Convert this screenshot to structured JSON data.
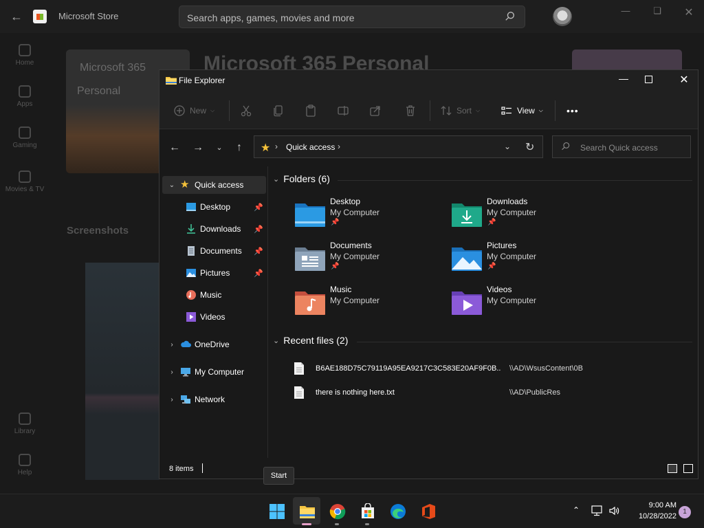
{
  "store": {
    "title": "Microsoft Store",
    "search_placeholder": "Search apps, games, movies and more",
    "nav": [
      "Home",
      "Apps",
      "Gaming",
      "Movies & TV",
      "Library",
      "Help"
    ],
    "hero_card_line1": "Microsoft 365",
    "hero_card_line2": "Personal",
    "heading": "Microsoft 365 Personal",
    "screenshots_label": "Screenshots"
  },
  "explorer": {
    "title": "File Explorer",
    "ribbon": {
      "new_label": "New",
      "sort_label": "Sort",
      "view_label": "View",
      "more_label": "•••"
    },
    "address": {
      "location": "Quick access"
    },
    "search_placeholder": "Search Quick access",
    "sidebar": {
      "items": [
        {
          "label": "Quick access",
          "icon": "star-icon",
          "pinned": false
        },
        {
          "label": "Desktop",
          "icon": "desktop-icon",
          "pinned": true
        },
        {
          "label": "Downloads",
          "icon": "download-icon",
          "pinned": true
        },
        {
          "label": "Documents",
          "icon": "document-icon",
          "pinned": true
        },
        {
          "label": "Pictures",
          "icon": "pictures-icon",
          "pinned": true
        },
        {
          "label": "Music",
          "icon": "music-icon",
          "pinned": false
        },
        {
          "label": "Videos",
          "icon": "video-icon",
          "pinned": false
        },
        {
          "label": "OneDrive",
          "icon": "cloud-icon",
          "pinned": false
        },
        {
          "label": "My Computer",
          "icon": "computer-icon",
          "pinned": false
        },
        {
          "label": "Network",
          "icon": "network-icon",
          "pinned": false
        }
      ]
    },
    "folders_header": "Folders (6)",
    "folders": [
      {
        "name": "Desktop",
        "location": "My Computer",
        "pinned": true,
        "icon": "desktop-folder-icon",
        "color": "#2b9ae3"
      },
      {
        "name": "Downloads",
        "location": "My Computer",
        "pinned": true,
        "icon": "downloads-folder-icon",
        "color": "#1fa98a"
      },
      {
        "name": "Documents",
        "location": "My Computer",
        "pinned": true,
        "icon": "documents-folder-icon",
        "color": "#8fa4ba"
      },
      {
        "name": "Pictures",
        "location": "My Computer",
        "pinned": true,
        "icon": "pictures-folder-icon",
        "color": "#2a8fe0"
      },
      {
        "name": "Music",
        "location": "My Computer",
        "pinned": false,
        "icon": "music-folder-icon",
        "color": "#e86e5a"
      },
      {
        "name": "Videos",
        "location": "My Computer",
        "pinned": false,
        "icon": "videos-folder-icon",
        "color": "#8b5ad8"
      }
    ],
    "recent_header": "Recent files (2)",
    "recent_files": [
      {
        "name": "B6AE188D75C79119A95EA9217C3C583E20AF9F0B...",
        "path": "\\\\AD\\WsusContent\\0B"
      },
      {
        "name": "there is nothing here.txt",
        "path": "\\\\AD\\PublicRes"
      }
    ],
    "status": "8 items"
  },
  "tooltip": "Start",
  "taskbar": {
    "apps": [
      "start-icon",
      "file-explorer-icon",
      "chrome-icon",
      "store-icon",
      "edge-icon",
      "office-icon"
    ],
    "time": "9:00 AM",
    "date": "10/28/2022",
    "notification_count": "1"
  }
}
